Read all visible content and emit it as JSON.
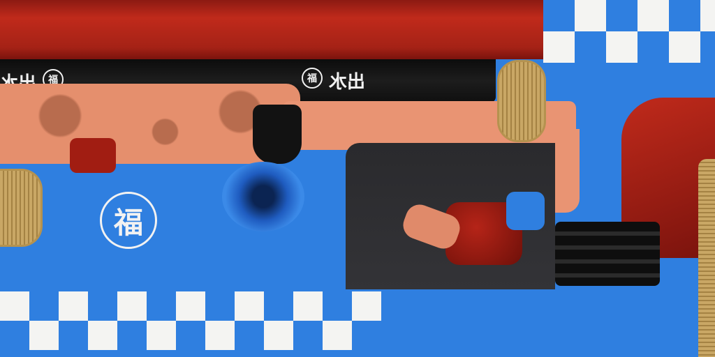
{
  "texture": {
    "type": "game-texture-atlas",
    "palette": {
      "base_blue": "#2f7fe0",
      "band_red": "#b52418",
      "dark_red": "#7a130d",
      "black_band": "#151515",
      "skin": "#e99473",
      "wrap_tan": "#c9a765",
      "checker_white": "#f4f4f2",
      "charcoal": "#2a2a2d"
    },
    "emblem": {
      "glyph": "福",
      "icon": "fortune-seal-icon"
    },
    "black_band_labels": [
      {
        "seal_glyph": "福",
        "text": "出水"
      },
      {
        "seal_glyph": "福",
        "text": "出水"
      }
    ]
  }
}
